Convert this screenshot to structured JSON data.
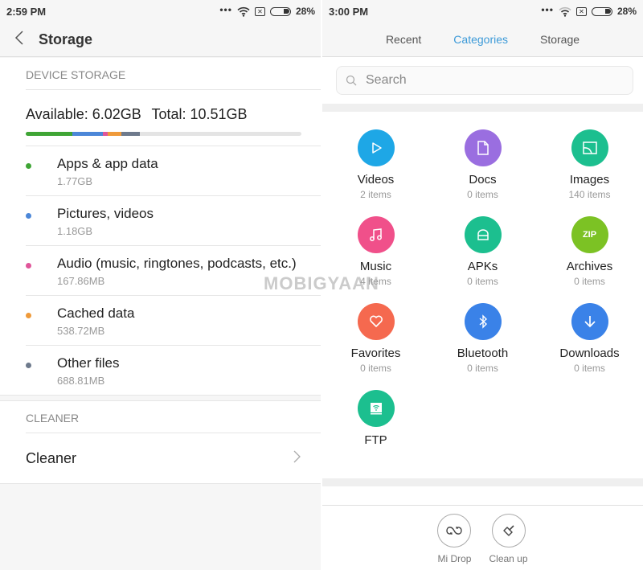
{
  "left": {
    "status": {
      "time": "2:59 PM",
      "battery": "28%"
    },
    "header": {
      "title": "Storage"
    },
    "device_storage": {
      "section_label": "DEVICE STORAGE",
      "available": "Available: 6.02GB",
      "total": "Total: 10.51GB",
      "usage_bar": [
        {
          "name": "Apps & app data",
          "fraction": 0.168,
          "color": "#3fa535"
        },
        {
          "name": "Pictures, videos",
          "fraction": 0.112,
          "color": "#4c87d8"
        },
        {
          "name": "Audio",
          "fraction": 0.016,
          "color": "#e0569a"
        },
        {
          "name": "Cached data",
          "fraction": 0.051,
          "color": "#ef9a3a"
        },
        {
          "name": "Other files",
          "fraction": 0.066,
          "color": "#6e7a8c"
        }
      ],
      "items": [
        {
          "name": "Apps & app data",
          "size": "1.77GB",
          "color": "#3fa535"
        },
        {
          "name": "Pictures, videos",
          "size": "1.18GB",
          "color": "#4c87d8"
        },
        {
          "name": "Audio (music, ringtones, podcasts, etc.)",
          "size": "167.86MB",
          "color": "#e0569a"
        },
        {
          "name": "Cached data",
          "size": "538.72MB",
          "color": "#ef9a3a"
        },
        {
          "name": "Other files",
          "size": "688.81MB",
          "color": "#6e7a8c"
        }
      ]
    },
    "cleaner": {
      "section_label": "CLEANER",
      "item_label": "Cleaner"
    }
  },
  "right": {
    "status": {
      "time": "3:00 PM",
      "battery": "28%"
    },
    "tabs": [
      {
        "label": "Recent",
        "active": false
      },
      {
        "label": "Categories",
        "active": true
      },
      {
        "label": "Storage",
        "active": false
      }
    ],
    "search": {
      "placeholder": "Search"
    },
    "categories": [
      {
        "name": "Videos",
        "count": "2 items",
        "icon": "play-icon",
        "color": "#1ea7e6"
      },
      {
        "name": "Docs",
        "count": "0 items",
        "icon": "document-icon",
        "color": "#9a6ee0"
      },
      {
        "name": "Images",
        "count": "140 items",
        "icon": "image-icon",
        "color": "#1cbf8f"
      },
      {
        "name": "Music",
        "count": "4 items",
        "icon": "music-note-icon",
        "color": "#f0508a"
      },
      {
        "name": "APKs",
        "count": "0 items",
        "icon": "android-icon",
        "color": "#1cbf8f"
      },
      {
        "name": "Archives",
        "count": "0 items",
        "icon": "zip-icon",
        "color": "#7cc224"
      },
      {
        "name": "Favorites",
        "count": "0 items",
        "icon": "heart-icon",
        "color": "#f5694f"
      },
      {
        "name": "Bluetooth",
        "count": "0 items",
        "icon": "bluetooth-icon",
        "color": "#3a82e8"
      },
      {
        "name": "Downloads",
        "count": "0 items",
        "icon": "download-icon",
        "color": "#3a82e8"
      },
      {
        "name": "FTP",
        "count": "",
        "icon": "ftp-icon",
        "color": "#1cbf8f"
      }
    ],
    "zip_text": "ZIP",
    "bottom_actions": [
      {
        "label": "Mi Drop",
        "icon": "mi-drop-icon"
      },
      {
        "label": "Clean up",
        "icon": "brush-icon"
      }
    ]
  },
  "watermark": "MOBIGYAAN"
}
